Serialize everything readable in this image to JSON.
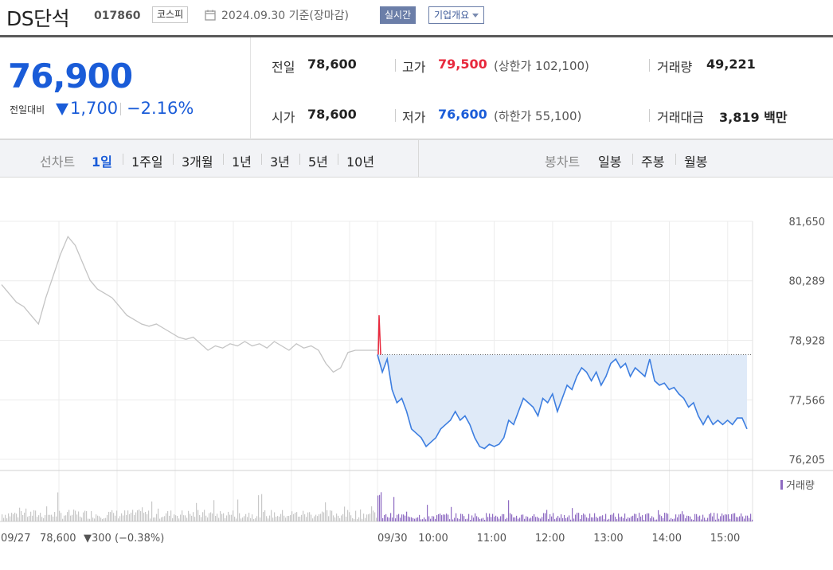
{
  "header": {
    "stock_name": "DS단석",
    "stock_code": "017860",
    "market": "코스피",
    "date_basis": "2024.09.30 기준(장마감)",
    "realtime_label": "실시간",
    "company_label": "기업개요"
  },
  "summary": {
    "price": "76,900",
    "change_label": "전일대비",
    "change": "1,700",
    "change_rate": "−2.16%",
    "prev_close_label": "전일",
    "prev_close": "78,600",
    "open_label": "시가",
    "open": "78,600",
    "high_label": "고가",
    "high": "79,500",
    "upper_limit": "(상한가 102,100)",
    "low_label": "저가",
    "low": "76,600",
    "lower_limit": "(하한가 55,100)",
    "volume_label": "거래량",
    "volume": "49,221",
    "amount_label": "거래대금",
    "amount": "3,819 백만"
  },
  "tabs": {
    "line_title": "선차트",
    "line_periods": [
      "1일",
      "1주일",
      "3개월",
      "1년",
      "3년",
      "5년",
      "10년"
    ],
    "active_period": "1일",
    "candle_title": "봉차트",
    "candle_periods": [
      "일봉",
      "주봉",
      "월봉"
    ]
  },
  "colors": {
    "up": "#e8283c",
    "down": "#1a5cd8",
    "today_line": "#3d7ee0",
    "today_fill": "#dfeaf8",
    "prev_line": "#c4c4c4",
    "volume_today": "#8f6bc2",
    "volume_prev": "#c8c8c8"
  },
  "chart_data": {
    "type": "line",
    "ylim": [
      76205,
      81650
    ],
    "y_ticks": [
      "81,650",
      "80,289",
      "78,928",
      "77,566",
      "76,205"
    ],
    "x_ticks": [
      "09/30",
      "10:00",
      "11:00",
      "12:00",
      "13:00",
      "14:00",
      "15:00"
    ],
    "prev_close": 78600,
    "prev_day_label": "09/27",
    "prev_day_close": "78,600",
    "prev_day_change": "▼300 (−0.38%)",
    "volume_legend": "거래량",
    "prev_day_series": [
      80200,
      80000,
      79800,
      79700,
      79500,
      79300,
      79900,
      80400,
      80900,
      81300,
      81100,
      80700,
      80300,
      80100,
      80000,
      79900,
      79700,
      79500,
      79400,
      79300,
      79250,
      79300,
      79200,
      79100,
      79000,
      78950,
      79000,
      78850,
      78700,
      78800,
      78750,
      78850,
      78800,
      78900,
      78800,
      78850,
      78750,
      78900,
      78800,
      78700,
      78850,
      78750,
      78800,
      78700,
      78400,
      78200,
      78300,
      78650,
      78700,
      78700,
      78700,
      78700
    ],
    "today_series": [
      {
        "t": "09:00",
        "v": 78600
      },
      {
        "t": "09:05",
        "v": 78200
      },
      {
        "t": "09:10",
        "v": 78500
      },
      {
        "t": "09:15",
        "v": 77800
      },
      {
        "t": "09:20",
        "v": 77500
      },
      {
        "t": "09:25",
        "v": 77600
      },
      {
        "t": "09:30",
        "v": 77300
      },
      {
        "t": "09:35",
        "v": 76900
      },
      {
        "t": "09:40",
        "v": 76800
      },
      {
        "t": "09:45",
        "v": 76700
      },
      {
        "t": "09:50",
        "v": 76500
      },
      {
        "t": "09:55",
        "v": 76600
      },
      {
        "t": "10:00",
        "v": 76700
      },
      {
        "t": "10:05",
        "v": 76900
      },
      {
        "t": "10:10",
        "v": 77000
      },
      {
        "t": "10:15",
        "v": 77100
      },
      {
        "t": "10:20",
        "v": 77300
      },
      {
        "t": "10:25",
        "v": 77100
      },
      {
        "t": "10:30",
        "v": 77200
      },
      {
        "t": "10:35",
        "v": 77000
      },
      {
        "t": "10:40",
        "v": 76700
      },
      {
        "t": "10:45",
        "v": 76500
      },
      {
        "t": "10:50",
        "v": 76450
      },
      {
        "t": "10:55",
        "v": 76550
      },
      {
        "t": "11:00",
        "v": 76500
      },
      {
        "t": "11:05",
        "v": 76550
      },
      {
        "t": "11:10",
        "v": 76700
      },
      {
        "t": "11:15",
        "v": 77100
      },
      {
        "t": "11:20",
        "v": 77000
      },
      {
        "t": "11:25",
        "v": 77300
      },
      {
        "t": "11:30",
        "v": 77600
      },
      {
        "t": "11:35",
        "v": 77500
      },
      {
        "t": "11:40",
        "v": 77400
      },
      {
        "t": "11:45",
        "v": 77200
      },
      {
        "t": "11:50",
        "v": 77600
      },
      {
        "t": "11:55",
        "v": 77500
      },
      {
        "t": "12:00",
        "v": 77700
      },
      {
        "t": "12:05",
        "v": 77300
      },
      {
        "t": "12:10",
        "v": 77600
      },
      {
        "t": "12:15",
        "v": 77900
      },
      {
        "t": "12:20",
        "v": 77800
      },
      {
        "t": "12:25",
        "v": 78100
      },
      {
        "t": "12:30",
        "v": 78300
      },
      {
        "t": "12:35",
        "v": 78200
      },
      {
        "t": "12:40",
        "v": 78000
      },
      {
        "t": "12:45",
        "v": 78200
      },
      {
        "t": "12:50",
        "v": 77900
      },
      {
        "t": "12:55",
        "v": 78100
      },
      {
        "t": "13:00",
        "v": 78400
      },
      {
        "t": "13:05",
        "v": 78500
      },
      {
        "t": "13:10",
        "v": 78300
      },
      {
        "t": "13:15",
        "v": 78400
      },
      {
        "t": "13:20",
        "v": 78100
      },
      {
        "t": "13:25",
        "v": 78300
      },
      {
        "t": "13:30",
        "v": 78200
      },
      {
        "t": "13:35",
        "v": 78100
      },
      {
        "t": "13:40",
        "v": 78500
      },
      {
        "t": "13:45",
        "v": 78000
      },
      {
        "t": "13:50",
        "v": 77900
      },
      {
        "t": "13:55",
        "v": 77950
      },
      {
        "t": "14:00",
        "v": 77800
      },
      {
        "t": "14:05",
        "v": 77850
      },
      {
        "t": "14:10",
        "v": 77700
      },
      {
        "t": "14:15",
        "v": 77600
      },
      {
        "t": "14:20",
        "v": 77400
      },
      {
        "t": "14:25",
        "v": 77500
      },
      {
        "t": "14:30",
        "v": 77200
      },
      {
        "t": "14:35",
        "v": 77000
      },
      {
        "t": "14:40",
        "v": 77200
      },
      {
        "t": "14:45",
        "v": 77000
      },
      {
        "t": "14:50",
        "v": 77100
      },
      {
        "t": "14:55",
        "v": 77000
      },
      {
        "t": "15:00",
        "v": 77100
      },
      {
        "t": "15:05",
        "v": 77000
      },
      {
        "t": "15:10",
        "v": 77150
      },
      {
        "t": "15:15",
        "v": 77150
      },
      {
        "t": "15:20",
        "v": 76900
      }
    ]
  }
}
